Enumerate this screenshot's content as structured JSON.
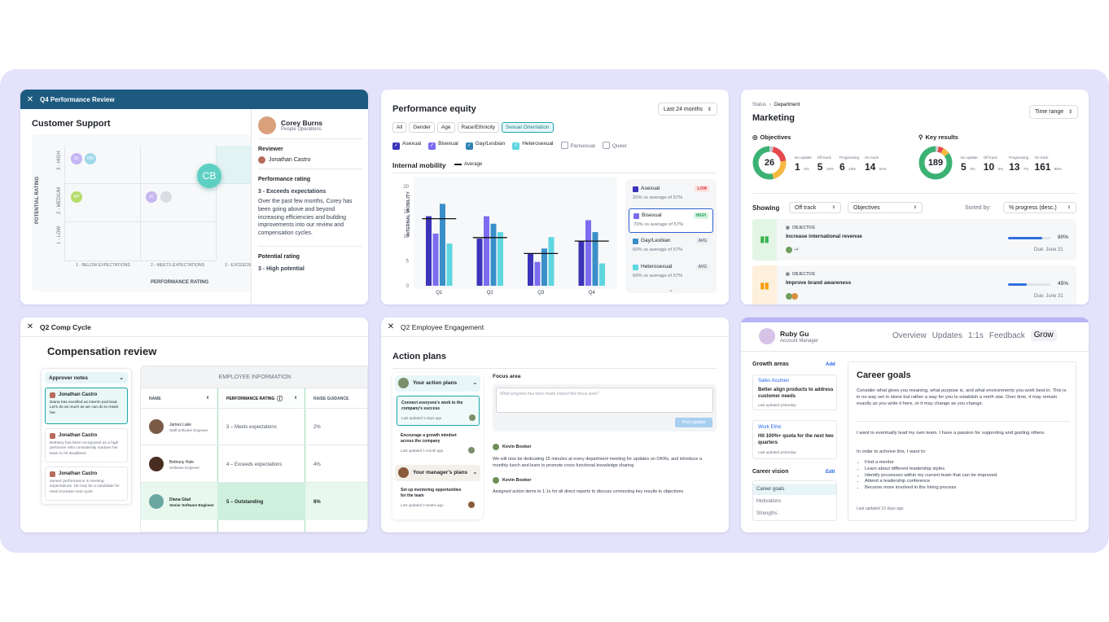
{
  "q4": {
    "header": "Q4 Performance Review",
    "team": "Customer Support",
    "ylabel": "POTENTIAL RATING",
    "xlabel": "PERFORMANCE RATING",
    "yticks": [
      "3 - HIGH",
      "2 - MEDIUM",
      "1 - LOW"
    ],
    "xticks": [
      "1 - BELOW EXPECTATIONS",
      "2 - MEETS EXPECTATIONS",
      "3 - EXCEEDS"
    ],
    "chips": [
      "SF",
      "RM",
      "BH",
      "JC",
      "CB"
    ],
    "person_name": "Corey Burns",
    "person_role": "People Operations",
    "reviewer_label": "Reviewer",
    "reviewer": "Jonathan Castro",
    "perf_label": "Performance rating",
    "perf_value": "3 - Exceeds expectations",
    "perf_text": "Over the past few months, Corey has been going above and beyond increasing efficiencies and building improvements into our review and compensation cycles.",
    "pot_label": "Potential rating",
    "pot_value": "3 - High potential"
  },
  "equity": {
    "title": "Performance equity",
    "range": "Last 24 months",
    "tabs": [
      "All",
      "Gender",
      "Age",
      "Race/Ethnicity",
      "Sexual Orientation"
    ],
    "filters": [
      "Asexual",
      "Bisexual",
      "Gay/Lesbian",
      "Heterosexual",
      "Pansexual",
      "Queer"
    ],
    "section": "Internal mobility",
    "avg_label": "Average",
    "ylabel": "INTERNAL MOBILITY",
    "legend": [
      {
        "name": "Asexual",
        "sub": "20% vs average of 57%",
        "badge": "LOW"
      },
      {
        "name": "Bisexual",
        "sub": "70% vs average of 57%",
        "badge": "HIGH"
      },
      {
        "name": "Gay/Lesbian",
        "sub": "60% vs average of 57%",
        "badge": "AVG"
      },
      {
        "name": "Heterosexual",
        "sub": "60% vs average of 57%",
        "badge": "AVG"
      }
    ],
    "colors": [
      "#3b33b8",
      "#7b6cf0",
      "#3a8fc8",
      "#5fd6e0"
    ]
  },
  "chart_data": {
    "type": "bar",
    "categories": [
      "Q1",
      "Q2",
      "Q3",
      "Q4"
    ],
    "series": [
      {
        "name": "Asexual",
        "values": [
          14,
          9.5,
          6.5,
          9
        ]
      },
      {
        "name": "Bisexual",
        "values": [
          10.5,
          14,
          4.8,
          13.2
        ]
      },
      {
        "name": "Gay/Lesbian",
        "values": [
          16.5,
          12.5,
          7.5,
          10.8
        ]
      },
      {
        "name": "Heterosexual",
        "values": [
          8.5,
          10.8,
          9.8,
          4.5
        ]
      }
    ],
    "averages": [
      13.5,
      9.7,
      6.5,
      9
    ],
    "ylim": [
      0,
      20
    ],
    "yticks": [
      0,
      5,
      10,
      15,
      20
    ]
  },
  "mkt": {
    "crumb1": "Status",
    "crumb2": "Department",
    "title": "Marketing",
    "range": "Time range",
    "obj_label": "Objectives",
    "kr_label": "Key results",
    "obj_total": "26",
    "kr_total": "189",
    "obj_stats": [
      {
        "l": "No update",
        "v": "1",
        "p": "4%"
      },
      {
        "l": "Off track",
        "v": "5",
        "p": "19%"
      },
      {
        "l": "Progressing",
        "v": "6",
        "p": "23%"
      },
      {
        "l": "On track",
        "v": "14",
        "p": "54%"
      }
    ],
    "kr_stats": [
      {
        "l": "No update",
        "v": "5",
        "p": "3%"
      },
      {
        "l": "Off track",
        "v": "10",
        "p": "5%"
      },
      {
        "l": "Progressing",
        "v": "13",
        "p": "7%"
      },
      {
        "l": "On track",
        "v": "161",
        "p": "85%"
      }
    ],
    "showing": "Showing",
    "f1": "Off track",
    "f2": "Objectives",
    "sorted": "Sorted by:",
    "sort": "% progress (desc.)",
    "rows": [
      {
        "tag": "OBJECTIVE",
        "name": "Increase international revenue",
        "pct": "80%",
        "pval": 0.8,
        "due": "Due:  June 31",
        "extra": "+4"
      },
      {
        "tag": "OBJECTIVE",
        "name": "Improve brand awareness",
        "pct": "45%",
        "pval": 0.45,
        "due": "Due:  June 31",
        "extra": ""
      }
    ]
  },
  "comp": {
    "header": "Q2 Comp Cycle",
    "title": "Compensation review",
    "notes_title": "Approver notes",
    "notes": [
      {
        "n": "Jonathan Castro",
        "t": "Diana has excelled as interim pod lead. Let's do as much as we can do to retain her."
      },
      {
        "n": "Jonathan Castro",
        "t": "Bethany has been recognized as a high performer who consistently outdoes her team to hit deadlines."
      },
      {
        "n": "Jonathan Castro",
        "t": "James' performance is meeting expectations. He may be a candidate for merit increase next cycle."
      }
    ],
    "group": "EMPLOYEE INFORMATION",
    "cols": [
      "NAME",
      "PERFORMANCE RATING",
      "RAISE GUIDANCE"
    ],
    "rows": [
      {
        "n": "James Lake",
        "r": "Staff Software Engineer",
        "p": "3 – Meets expectations",
        "g": "2%"
      },
      {
        "n": "Bethany Hale",
        "r": "Software Engineer",
        "p": "4 – Exceeds expectations",
        "g": "4%"
      },
      {
        "n": "Diana Glad",
        "r": "Senior Software Engineer",
        "p": "5 – Outstanding",
        "g": "8%"
      }
    ]
  },
  "eng": {
    "header": "Q2 Employee Engagement",
    "title": "Action plans",
    "your": "Your action plans",
    "p1": "Connect everyone's work to the company's success",
    "p1d": "Last updated 2 days ago",
    "p2": "Encourage a growth mindset across the company",
    "p2d": "Last updated 1 month ago",
    "mgr": "Your manager's plans",
    "p3": "Set up mentoring opportunities for the team",
    "p3d": "Last updated 2 weeks ago",
    "focus": "Focus area",
    "placeholder": "What progress has been made toward this focus area?",
    "post": "Post update",
    "u1": "Kevin Booker",
    "u1t": "We will now be dedicating 15 minutes at every department meeting for updates on OKRs, and introduce a monthly lunch and learn to promote cross functional knowledge sharing",
    "u2": "Kevin Booker",
    "u2t": "Assigned action items to 1:1s for all direct reports to discuss connecting key results to objectives"
  },
  "grow": {
    "name": "Ruby Gu",
    "role": "Account Manager",
    "tabs": [
      "Overview",
      "Updates",
      "1:1s",
      "Feedback",
      "Grow"
    ],
    "areas": "Growth areas",
    "add": "Add",
    "a1cat": "Sales Acumen",
    "a1": "Better align products to address customer needs",
    "a1d": "Last updated yesterday",
    "a2cat": "Work Ethic",
    "a2": "Hit 100%+ quota for the next two quarters",
    "a2d": "Last updated yesterday",
    "vision": "Career vision",
    "edit": "Edit",
    "vitems": [
      "Career goals",
      "Motivations",
      "Strengths"
    ],
    "goal_title": "Career goals",
    "p1": "Consider what gives you meaning, what purpose is, and what environments you work best in. This is in no way set in stone but rather a way for you to establish a north star. Over time, it may remain exactly as you write it here, or it may change as you change.",
    "p2": "I want to eventually lead my own team. I have a passion for supporting and guiding others.",
    "p3": "In order to acheive this, I want to:",
    "bullets": [
      "Find a mentor",
      "Learn about different leadership styles",
      "Identify prcoesses within my current team that can be improved",
      "Attend a leadership conference",
      "Become more involved in the hiring process"
    ],
    "updated": "Last updated 10 days ago"
  }
}
